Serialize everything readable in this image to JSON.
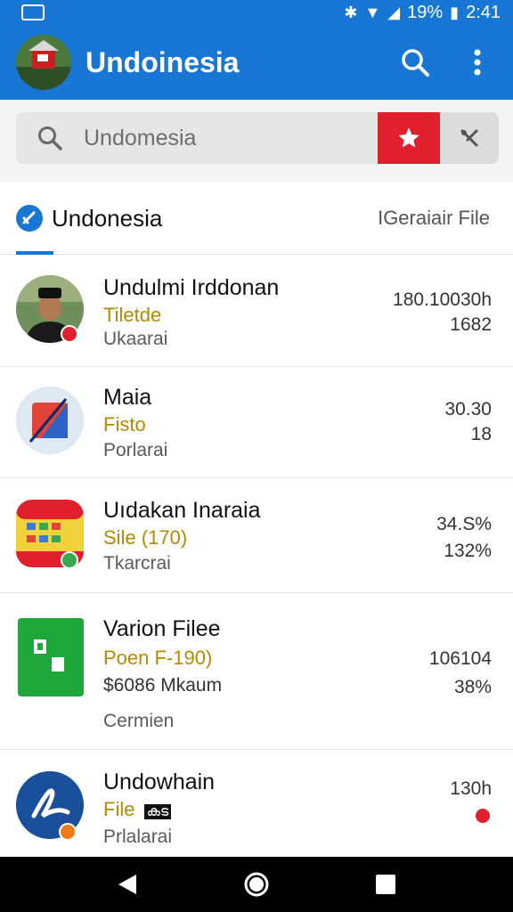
{
  "status_bar": {
    "battery": "19%",
    "time": "2:41"
  },
  "app_bar": {
    "title": "Undoinesia"
  },
  "search": {
    "value": "Undomesia",
    "placeholder": "Undomesia"
  },
  "tab": {
    "active_label": "Undonesia",
    "right_label": "IGeraiair File"
  },
  "colors": {
    "primary": "#1877d4",
    "accent_red": "#e0202c",
    "subtitle_gold": "#b38b00"
  },
  "rows": [
    {
      "title": "Undulmi Irddonan",
      "sub": "Tiletde",
      "sub2": "Ukaarai",
      "value1": "180.10030h",
      "value2": "1682",
      "thumb_icon": "person-photo-icon"
    },
    {
      "title": "Maia",
      "sub": "Fisto",
      "sub2": "Porlarai",
      "value1": "30.30",
      "value2": "18",
      "thumb_icon": "pdf-app-icon"
    },
    {
      "title": "Uıdakan Inaraia",
      "sub": "Sile (170)",
      "sub2": "Tkarcrai",
      "value1": "34.S%",
      "value2": "132%",
      "thumb_icon": "gallery-app-icon"
    },
    {
      "title": "Varion Filee",
      "sub": "Poen F-190)",
      "sub2": "$6086 Mkaum",
      "sub3": "Cermien",
      "value1": "106104",
      "value2": "38%",
      "thumb_icon": "spreadsheet-app-icon"
    },
    {
      "title": "Undowhain",
      "sub": "File",
      "sub_tag": "കട",
      "sub2": "Prlalarai",
      "value1": "130h",
      "value2": "",
      "thumb_icon": "acrobat-app-icon"
    }
  ]
}
